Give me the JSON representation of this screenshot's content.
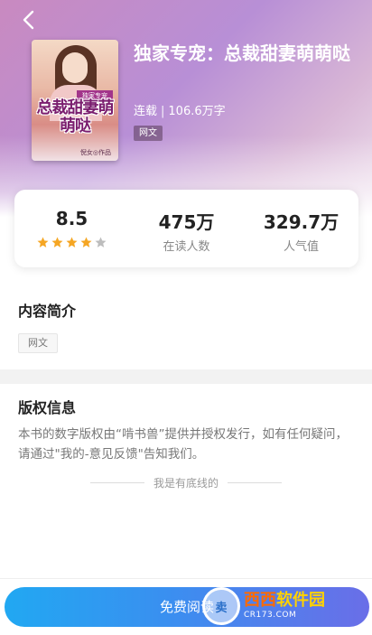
{
  "header": {
    "back_icon": "chevron-left-icon"
  },
  "book": {
    "title": "独家专宠：总裁甜妻萌萌哒",
    "status": "连载",
    "separator": "|",
    "word_count": "106.6万字",
    "genre_tag": "网文",
    "cover": {
      "band_text": "独家专宠",
      "title_text": "总裁甜妻萌萌哒",
      "author_text": "倪女◎作品"
    }
  },
  "stats": {
    "rating": "8.5",
    "rating_stars": 4.5,
    "star_color": "#f5a623",
    "readers_value": "475万",
    "readers_label": "在读人数",
    "popularity_value": "329.7万",
    "popularity_label": "人气值"
  },
  "intro": {
    "title": "内容简介",
    "tag": "网文"
  },
  "copyright": {
    "title": "版权信息",
    "text": "本书的数字版权由“啃书兽”提供并授权发行，如有任何疑问，请通过\"我的-意见反馈\"告知我们。"
  },
  "bottom_line": {
    "text": "我是有底线的"
  },
  "footer": {
    "read_button_label": "免费阅读",
    "watermark": {
      "circle_text": "卖",
      "main_a": "西西",
      "main_b": "软件园",
      "sub": "CR173.COM"
    }
  }
}
